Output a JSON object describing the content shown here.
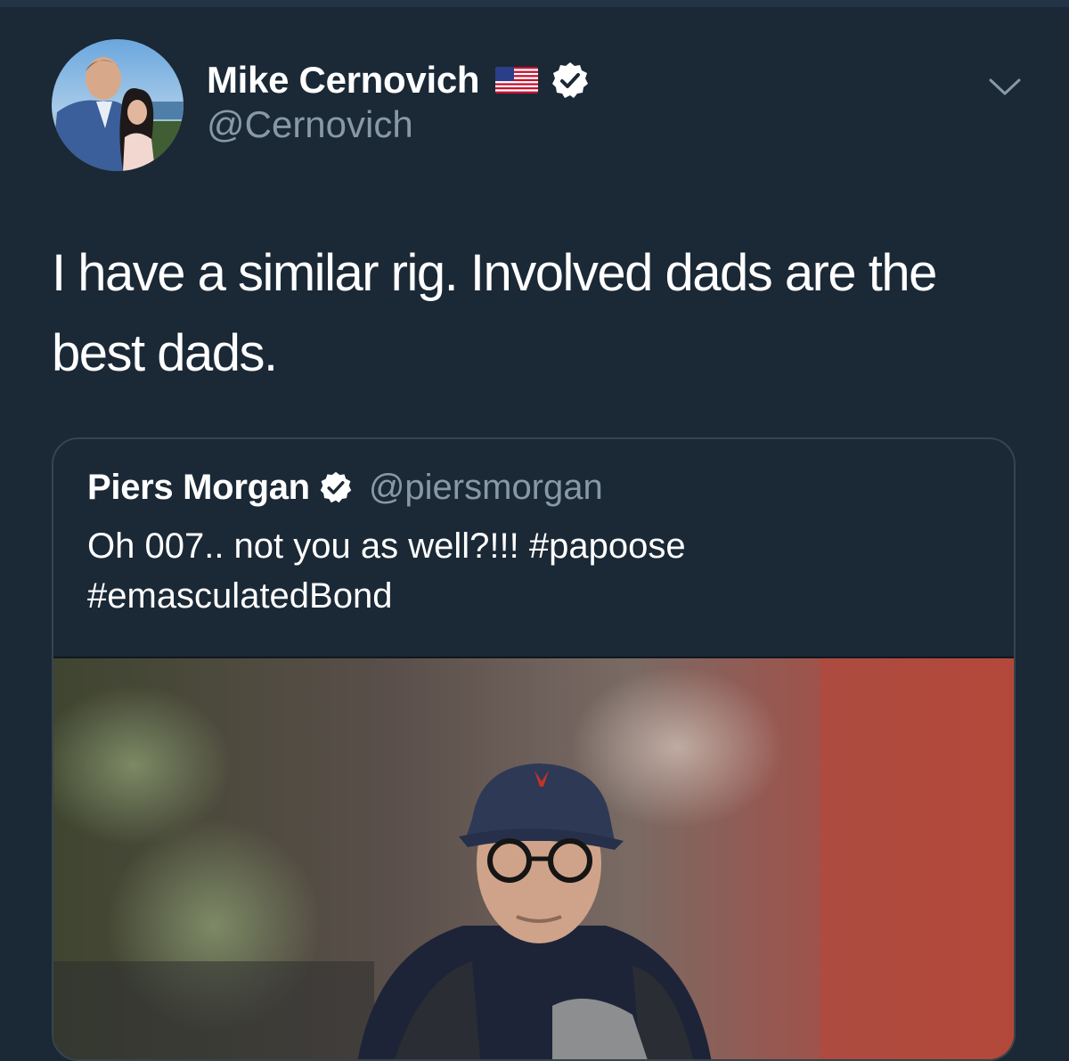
{
  "tweet": {
    "author": {
      "display_name": "Mike Cernovich",
      "handle": "@Cernovich",
      "flag_icon": "us-flag-icon",
      "verified_icon": "verified-badge-icon",
      "avatar_icon": "profile-photo-avatar"
    },
    "text": "I have a similar rig. Involved dads are the best dads.",
    "menu_icon": "chevron-down-icon",
    "quoted": {
      "display_name": "Piers Morgan",
      "handle": "@piersmorgan",
      "verified_icon": "verified-badge-icon",
      "text_line1": "Oh 007.. not you as well?!!! #papoose",
      "text_line2": "#emasculatedBond",
      "media_icon": "photo-of-man-in-cap-and-glasses"
    }
  },
  "colors": {
    "background": "#1b2836",
    "text": "#ffffff",
    "muted": "#8899a6",
    "border": "#38444d"
  }
}
